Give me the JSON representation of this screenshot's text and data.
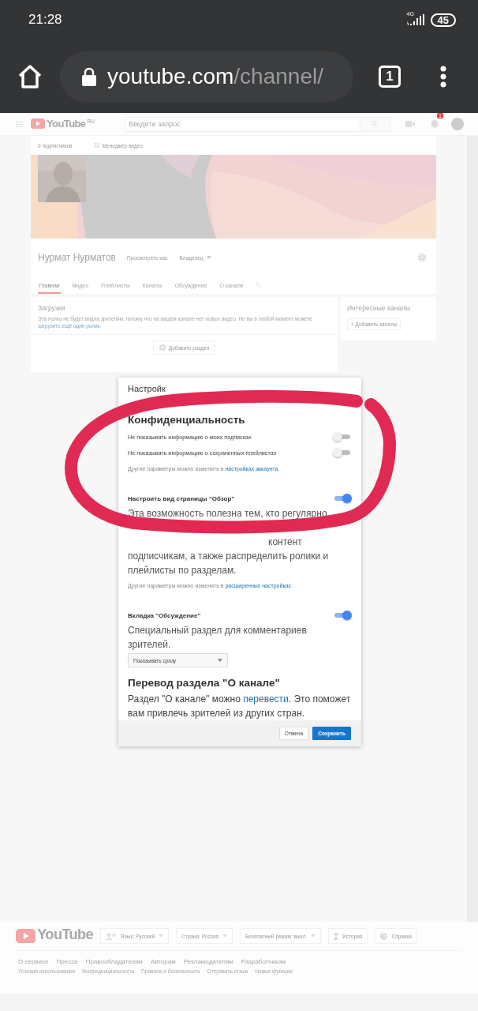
{
  "status_bar": {
    "time": "21:28",
    "network": "4G",
    "battery": "45"
  },
  "browser": {
    "url_host": "youtube.com",
    "url_path": "/channel/",
    "tab_count": "1"
  },
  "header": {
    "logo": "YouTube",
    "region": "RU",
    "search_placeholder": "Введите запрос",
    "notifications": "1"
  },
  "channel": {
    "subscribers": "0 подписчиков",
    "video_manager": "Менеджер видео",
    "name": "Нурмат Нурматов",
    "view_as_label": "Просмотреть как:",
    "view_as_value": "Владелец",
    "tabs": [
      {
        "label": "Главная",
        "selected": true
      },
      {
        "label": "Видео",
        "selected": false
      },
      {
        "label": "Плейлисты",
        "selected": false
      },
      {
        "label": "Каналы",
        "selected": false
      },
      {
        "label": "Обсуждение",
        "selected": false
      },
      {
        "label": "О канале",
        "selected": false
      }
    ],
    "uploads": {
      "title": "Загрузки",
      "text": "Эта полка не будет видна зрителям, потому что на вашем канале нет новых видео. Но вы в любой момент можете ",
      "link": "загрузить ещё один ролик",
      "tail": ".",
      "add_section": "Добавить раздел"
    },
    "featured": {
      "title": "Интересные каналы",
      "add_button": "+ Добавить каналы"
    }
  },
  "dialog": {
    "title": "Настройк",
    "privacy": {
      "heading": "Конфиденциальность",
      "toggles": [
        {
          "label": "Не показывать информацию о моих подписках",
          "on": false
        },
        {
          "label": "Не показывать информацию о сохраненных плейлистах",
          "on": false
        }
      ],
      "note": "Другие параметры можно изменить в ",
      "note_link": "настройках аккаунта",
      "note_tail": "."
    },
    "browse": {
      "label": "Настроить вид страницы \"Обзор\"",
      "on": true,
      "lines": [
        "Эта возможность полезна тем, кто регулярно",
        "контент",
        "подписчикам, а также распределить ролики и",
        "плейлисты по разделам."
      ],
      "note": "Другие параметры можно изменить в ",
      "note_link": "расширенных настройках",
      "note_tail": "."
    },
    "discussion": {
      "label": "Вкладка \"Обсуждение\"",
      "on": true,
      "text": "Специальный раздел для комментариев зрителей.",
      "select": "Показывать сразу"
    },
    "translation": {
      "heading": "Перевод раздела \"О канале\"",
      "text": "Раздел \"О канале\" можно ",
      "link": "перевести",
      "tail": ". Это поможет вам привлечь зрителей из других стран."
    },
    "buttons": [
      {
        "label": "Отмена",
        "kind": "secondary"
      },
      {
        "label": "Сохранить",
        "kind": "primary"
      }
    ]
  },
  "footer": {
    "logo": "YouTube",
    "controls": [
      {
        "label": "Язык: Русский",
        "kind": "language"
      },
      {
        "label": "Страна: Россия",
        "kind": "dropdown"
      },
      {
        "label": "Безопасный режим: выкл.",
        "kind": "dropdown"
      },
      {
        "label": "История",
        "kind": "history"
      },
      {
        "label": "Справка",
        "kind": "help"
      }
    ],
    "links": [
      "О сервисе",
      "Прессе",
      "Правообладателям",
      "Авторам",
      "Рекламодателям",
      "Разработчикам"
    ],
    "small_links": [
      "Условия использования",
      "Конфиденциальность",
      "Правила и безопасность",
      "Отправить отзыв",
      "Новые функции"
    ]
  }
}
